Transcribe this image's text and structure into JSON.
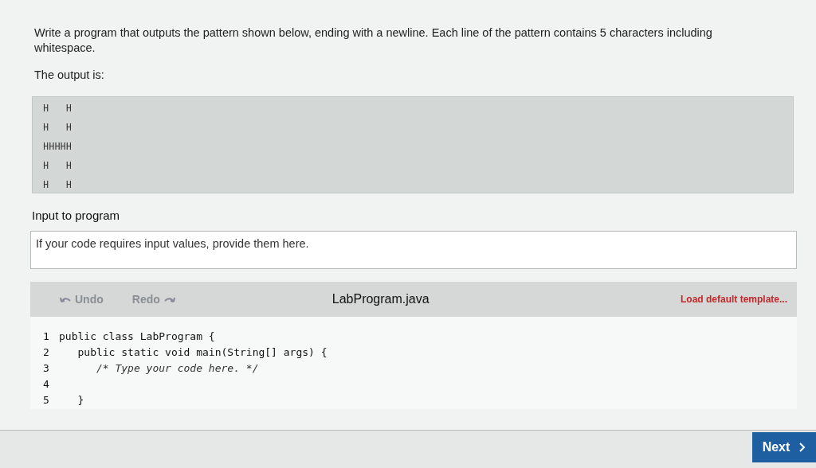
{
  "prompt": "Write a program that outputs the pattern shown below, ending with a newline. Each line of the pattern contains 5 characters including whitespace.",
  "output_label": "The output is:",
  "output_lines": [
    "H   H",
    "H   H",
    "HHHHH",
    "H   H",
    "H   H"
  ],
  "input": {
    "label": "Input to program",
    "placeholder": "If your code requires input values, provide them here."
  },
  "editor": {
    "undo": {
      "label": "Undo",
      "disabled": true
    },
    "redo": {
      "label": "Redo",
      "disabled": true
    },
    "filename": "LabProgram.java",
    "load_template": "Load default template...",
    "lines": [
      {
        "number": "1",
        "code": "public class LabProgram {"
      },
      {
        "number": "2",
        "code": "   public static void main(String[] args) {"
      },
      {
        "number": "3",
        "code": "      /* Type your code here. */",
        "kind": "comment"
      },
      {
        "number": "4"
      },
      {
        "number": "5",
        "code": "   }"
      }
    ]
  },
  "next_button": "Next"
}
